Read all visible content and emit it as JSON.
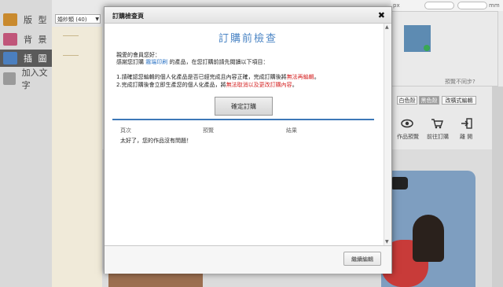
{
  "sidebar": {
    "items": [
      {
        "label": "版 型",
        "icon": "layout-icon",
        "color": "#c98a2e"
      },
      {
        "label": "背 景",
        "icon": "background-icon",
        "color": "#c0567a"
      },
      {
        "label": "插 圖",
        "icon": "illustration-icon",
        "color": "#4b7fbf"
      },
      {
        "label": "加入文字",
        "icon": "add-text-icon",
        "color": "#9a9a9a"
      }
    ],
    "active_index": 2
  },
  "category_select": {
    "value": "婚紗類 (40)"
  },
  "topbar": {
    "unit_px": "px",
    "unit_mm": "mm"
  },
  "preview_hint": "預覽不同步?",
  "mode_buttons": [
    "白色殼",
    "黑色殼",
    "改橫式編輯"
  ],
  "tools": [
    {
      "label": "作品預覽",
      "icon": "eye-icon"
    },
    {
      "label": "前往訂購",
      "icon": "cart-icon"
    },
    {
      "label": "離 開",
      "icon": "exit-icon"
    }
  ],
  "dialog": {
    "title": "訂購檢查頁",
    "close_symbol": "✖",
    "heading": "訂購前檢查",
    "greeting": "親愛的會員您好：",
    "intro_prefix": "感謝您訂購 ",
    "product_name": "霧端印刷",
    "intro_suffix": " 的產品，在您訂購前請先閱讀以下項目：",
    "notice1_prefix": "1.請確認您編輯的個人化產品是否已經完成且內容正確，完成訂購後將",
    "notice1_highlight": "無法再編輯",
    "notice1_suffix": "。",
    "notice2_prefix": "2.完成訂購後會立即生產您的個人化產品，將",
    "notice2_highlight": "無法取消以及更改訂購內容",
    "notice2_suffix": "。",
    "confirm_label": "確定訂購",
    "columns": [
      "頁次",
      "預覽",
      "結果"
    ],
    "result_text": "太好了，您的作品沒有問題！",
    "continue_label": "繼續編輯",
    "colors": {
      "heading": "#4a84c4",
      "highlight_blue": "#2f76c6",
      "highlight_red": "#d52323",
      "divider": "#3c78b8"
    }
  }
}
